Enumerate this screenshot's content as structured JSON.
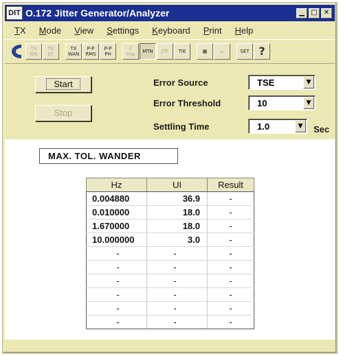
{
  "app": {
    "logo_text": "DIT",
    "title": "O.172 Jitter Generator/Analyzer",
    "window_buttons": {
      "minimize": "▁",
      "maximize": "□",
      "close": "✕"
    }
  },
  "menu": [
    {
      "label": "TX",
      "mnemonic": "T"
    },
    {
      "label": "Mode",
      "mnemonic": "M"
    },
    {
      "label": "View",
      "mnemonic": "V"
    },
    {
      "label": "Settings",
      "mnemonic": "S"
    },
    {
      "label": "Keyboard",
      "mnemonic": "K"
    },
    {
      "label": "Print",
      "mnemonic": "P"
    },
    {
      "label": "Help",
      "mnemonic": "H"
    }
  ],
  "toolbar": {
    "logo_icon": "dit-logo-icon",
    "buttons": [
      {
        "label": "TX\nON",
        "state": "disabled"
      },
      {
        "label": "TX\nJIT",
        "state": "disabled"
      },
      {
        "label": "TX\nWAN",
        "state": "normal"
      },
      {
        "label": "P-P\nRMS",
        "state": "normal"
      },
      {
        "label": "P-P\nPH",
        "state": "normal"
      },
      {
        "label": "F\nrng",
        "state": "disabled"
      },
      {
        "label": "MTN",
        "state": "active"
      },
      {
        "label": "JTF",
        "state": "disabled"
      },
      {
        "label": "TIE",
        "state": "normal"
      },
      {
        "label": "▦",
        "state": "normal"
      },
      {
        "label": "⊾",
        "state": "disabled"
      },
      {
        "label": "SET",
        "state": "normal"
      },
      {
        "label": "?",
        "state": "normal"
      }
    ]
  },
  "controls": {
    "start_label": "Start",
    "stop_label": "Stop",
    "error_source": {
      "label": "Error Source",
      "value": "TSE"
    },
    "error_threshold": {
      "label": "Error Threshold",
      "value": "10"
    },
    "settling_time": {
      "label": "Settling Time",
      "value": "1.0",
      "unit": "Sec"
    },
    "dropdown_arrow": "▼"
  },
  "measurement_mode": "MAX. TOL. WANDER",
  "table": {
    "headers": [
      "Hz",
      "UI",
      "Result"
    ],
    "rows": [
      [
        "0.004880",
        "36.9",
        "-"
      ],
      [
        "0.010000",
        "18.0",
        "-"
      ],
      [
        "1.670000",
        "18.0",
        "-"
      ],
      [
        "10.000000",
        "3.0",
        "-"
      ],
      [
        "-",
        "-",
        "-"
      ],
      [
        "-",
        "-",
        "-"
      ],
      [
        "-",
        "-",
        "-"
      ],
      [
        "-",
        "-",
        "-"
      ],
      [
        "-",
        "-",
        "-"
      ],
      [
        "-",
        "-",
        "-"
      ]
    ]
  }
}
